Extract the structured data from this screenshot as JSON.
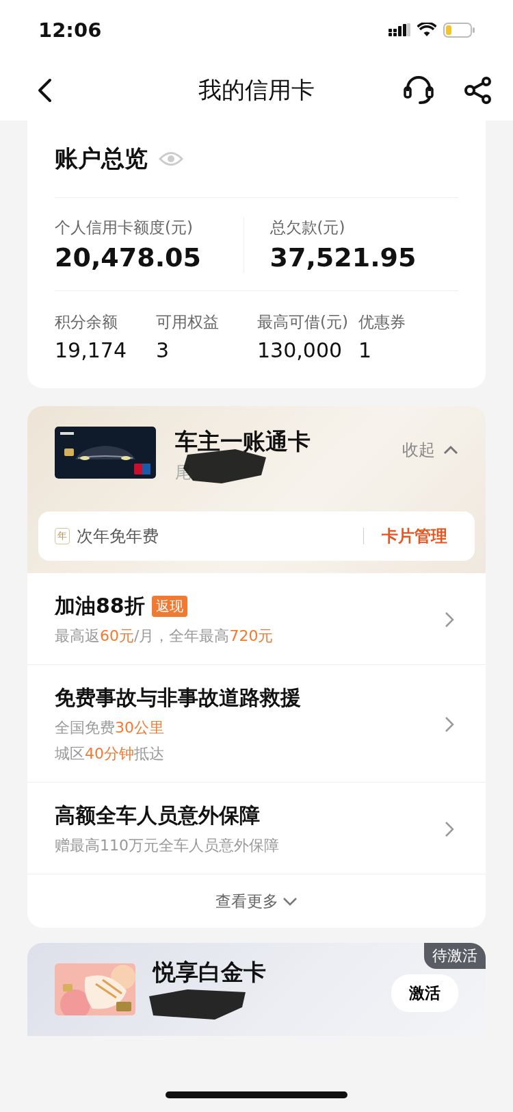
{
  "status_bar": {
    "time": "12:06"
  },
  "nav": {
    "title": "我的信用卡"
  },
  "overview": {
    "title": "账户总览",
    "primary": [
      {
        "label": "个人信用卡额度(元)",
        "value": "20,478.05"
      },
      {
        "label": "总欠款(元)",
        "value": "37,521.95"
      }
    ],
    "secondary": [
      {
        "label": "积分余额",
        "value": "19,174"
      },
      {
        "label": "可用权益",
        "value": "3"
      },
      {
        "label": "最高可借(元)",
        "value": "130,000"
      },
      {
        "label": "优惠券",
        "value": "1"
      }
    ]
  },
  "main_card": {
    "name": "车主一账通卡",
    "tail": "尾",
    "toggle": "收起",
    "expanded": true,
    "fee_badge": "年",
    "fee_text": "次年免年费",
    "manage": "卡片管理",
    "benefits": [
      {
        "title": "加油88折",
        "tag": "返现",
        "lines": [
          [
            {
              "text": "最高返",
              "highlight": false
            },
            {
              "text": "60元",
              "highlight": true
            },
            {
              "text": "/月，全年最高",
              "highlight": false
            },
            {
              "text": "720元",
              "highlight": true
            }
          ]
        ]
      },
      {
        "title": "免费事故与非事故道路救援",
        "lines": [
          [
            {
              "text": "全国免费",
              "highlight": false
            },
            {
              "text": "30公里",
              "highlight": true
            }
          ],
          [
            {
              "text": "城区",
              "highlight": false
            },
            {
              "text": "40分钟",
              "highlight": true
            },
            {
              "text": "抵达",
              "highlight": false
            }
          ]
        ]
      },
      {
        "title": "高额全车人员意外保障",
        "lines": [
          [
            {
              "text": "赠最高110万元全车人员意外保障",
              "highlight": false
            }
          ]
        ]
      }
    ],
    "more": "查看更多"
  },
  "pending_card": {
    "name": "悦享白金卡",
    "status": "待激活",
    "action": "激活"
  }
}
